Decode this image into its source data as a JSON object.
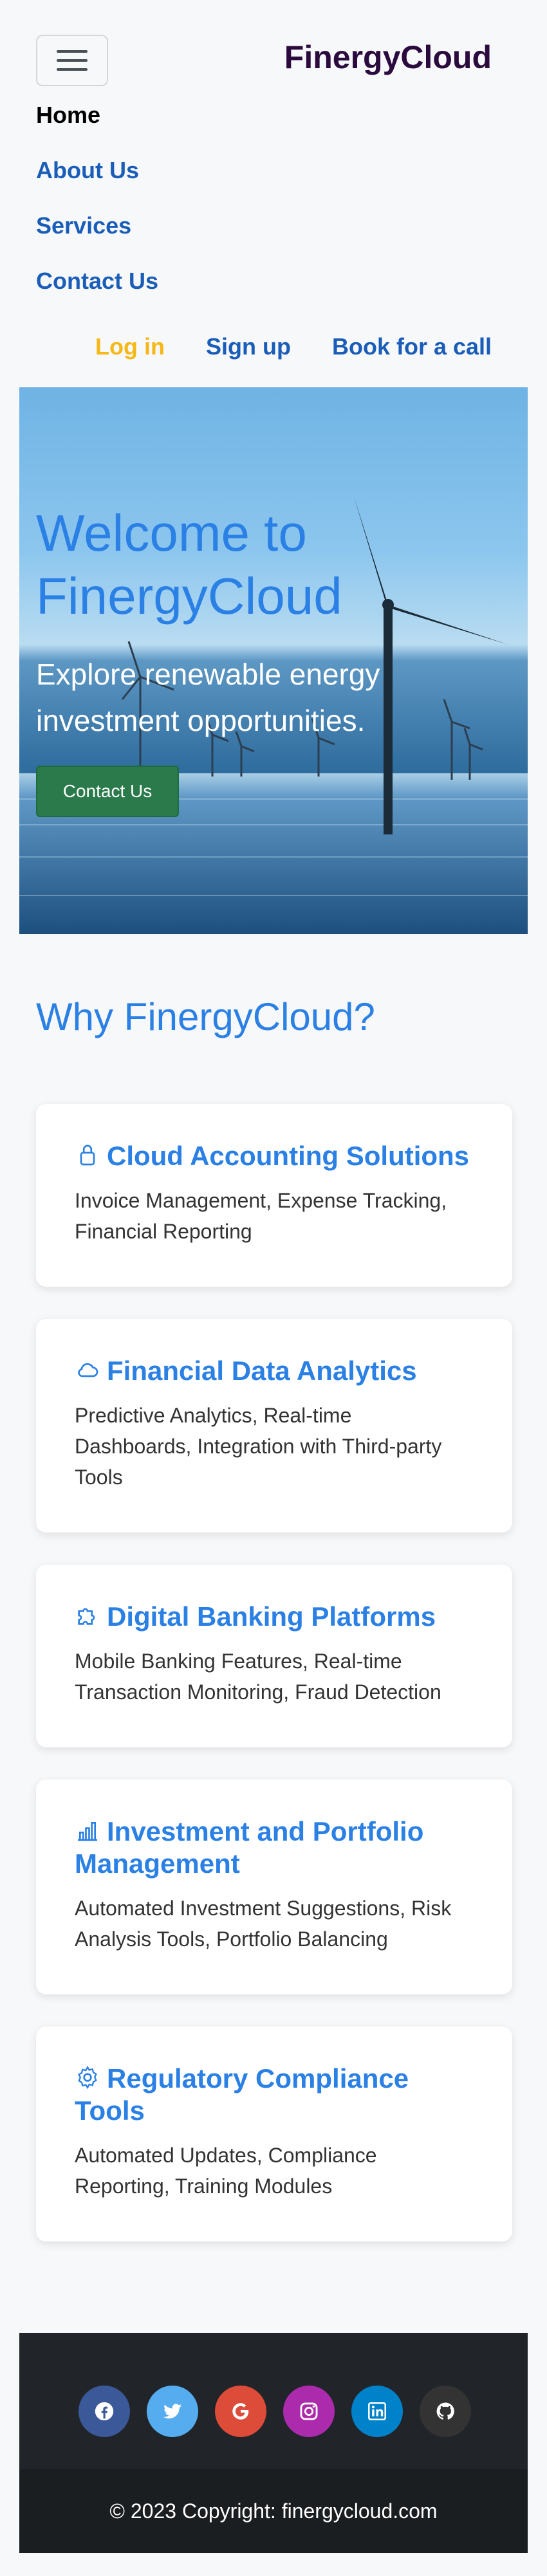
{
  "header": {
    "brand": "FinergyCloud",
    "nav": [
      "Home",
      "About Us",
      "Services",
      "Contact Us"
    ],
    "login": "Log in",
    "signup": "Sign up",
    "book": "Book for a call"
  },
  "hero": {
    "title": "Welcome to FinergyCloud",
    "subtitle": "Explore renewable energy investment opportunities.",
    "cta": "Contact Us"
  },
  "why": {
    "heading": "Why FinergyCloud?"
  },
  "cards": [
    {
      "icon": "lock-icon",
      "title": "Cloud Accounting Solutions",
      "text": "Invoice Management, Expense Tracking, Financial Reporting"
    },
    {
      "icon": "cloud-icon",
      "title": "Financial Data Analytics",
      "text": "Predictive Analytics, Real-time Dashboards, Integration with Third-party Tools"
    },
    {
      "icon": "puzzle-icon",
      "title": "Digital Banking Platforms",
      "text": "Mobile Banking Features, Real-time Transaction Monitoring, Fraud Detection"
    },
    {
      "icon": "bar-chart-icon",
      "title": "Investment and Portfolio Management",
      "text": "Automated Investment Suggestions, Risk Analysis Tools, Portfolio Balancing"
    },
    {
      "icon": "gear-icon",
      "title": "Regulatory Compliance Tools",
      "text": "Automated Updates, Compliance Reporting, Training Modules"
    }
  ],
  "footer": {
    "socials": [
      {
        "icon": "facebook-icon",
        "color": "#3b5998"
      },
      {
        "icon": "twitter-icon",
        "color": "#55acee"
      },
      {
        "icon": "google-icon",
        "color": "#dd4b39"
      },
      {
        "icon": "instagram-icon",
        "color": "#ac2bac"
      },
      {
        "icon": "linkedin-icon",
        "color": "#0082ca"
      },
      {
        "icon": "github-icon",
        "color": "#333333"
      }
    ],
    "copyright": "© 2023 Copyright: finergycloud.com"
  },
  "colors": {
    "accent": "#2a80e4",
    "brand": "#2b0a3d",
    "link": "#1a5db8",
    "login": "#f5b817",
    "cta": "#2b7a4b"
  }
}
